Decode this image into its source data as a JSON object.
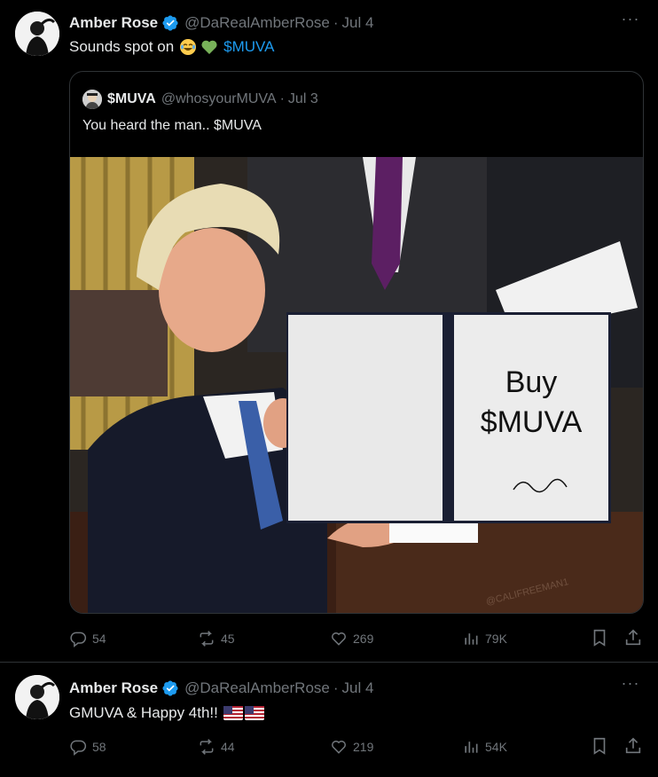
{
  "tweets": [
    {
      "author": "Amber Rose",
      "handle": "@DaRealAmberRose",
      "date": "Jul 4",
      "text": "Sounds spot on",
      "link": "$MUVA",
      "emojis": [
        "joy-emoji",
        "green-heart-emoji"
      ],
      "quote": {
        "author": "$MUVA",
        "handle": "@whosyourMUVA",
        "date": "Jul 3",
        "text": "You heard the man.. $MUVA",
        "image_sign_text_1": "Buy",
        "image_sign_text_2": "$MUVA",
        "watermark": "@CALIFREEMAN1"
      },
      "stats": {
        "replies": "54",
        "reposts": "45",
        "likes": "269",
        "views": "79K"
      }
    },
    {
      "author": "Amber Rose",
      "handle": "@DaRealAmberRose",
      "date": "Jul 4",
      "text": "GMUVA & Happy 4th!!",
      "emojis": [
        "us-flag-emoji",
        "us-flag-emoji"
      ],
      "stats": {
        "replies": "58",
        "reposts": "44",
        "likes": "219",
        "views": "54K"
      }
    }
  ],
  "colors": {
    "background": "#000000",
    "text": "#e7e9ea",
    "muted": "#71767b",
    "accent": "#1d9bf0",
    "border": "#2f3336",
    "verified": "#1d9bf0"
  }
}
